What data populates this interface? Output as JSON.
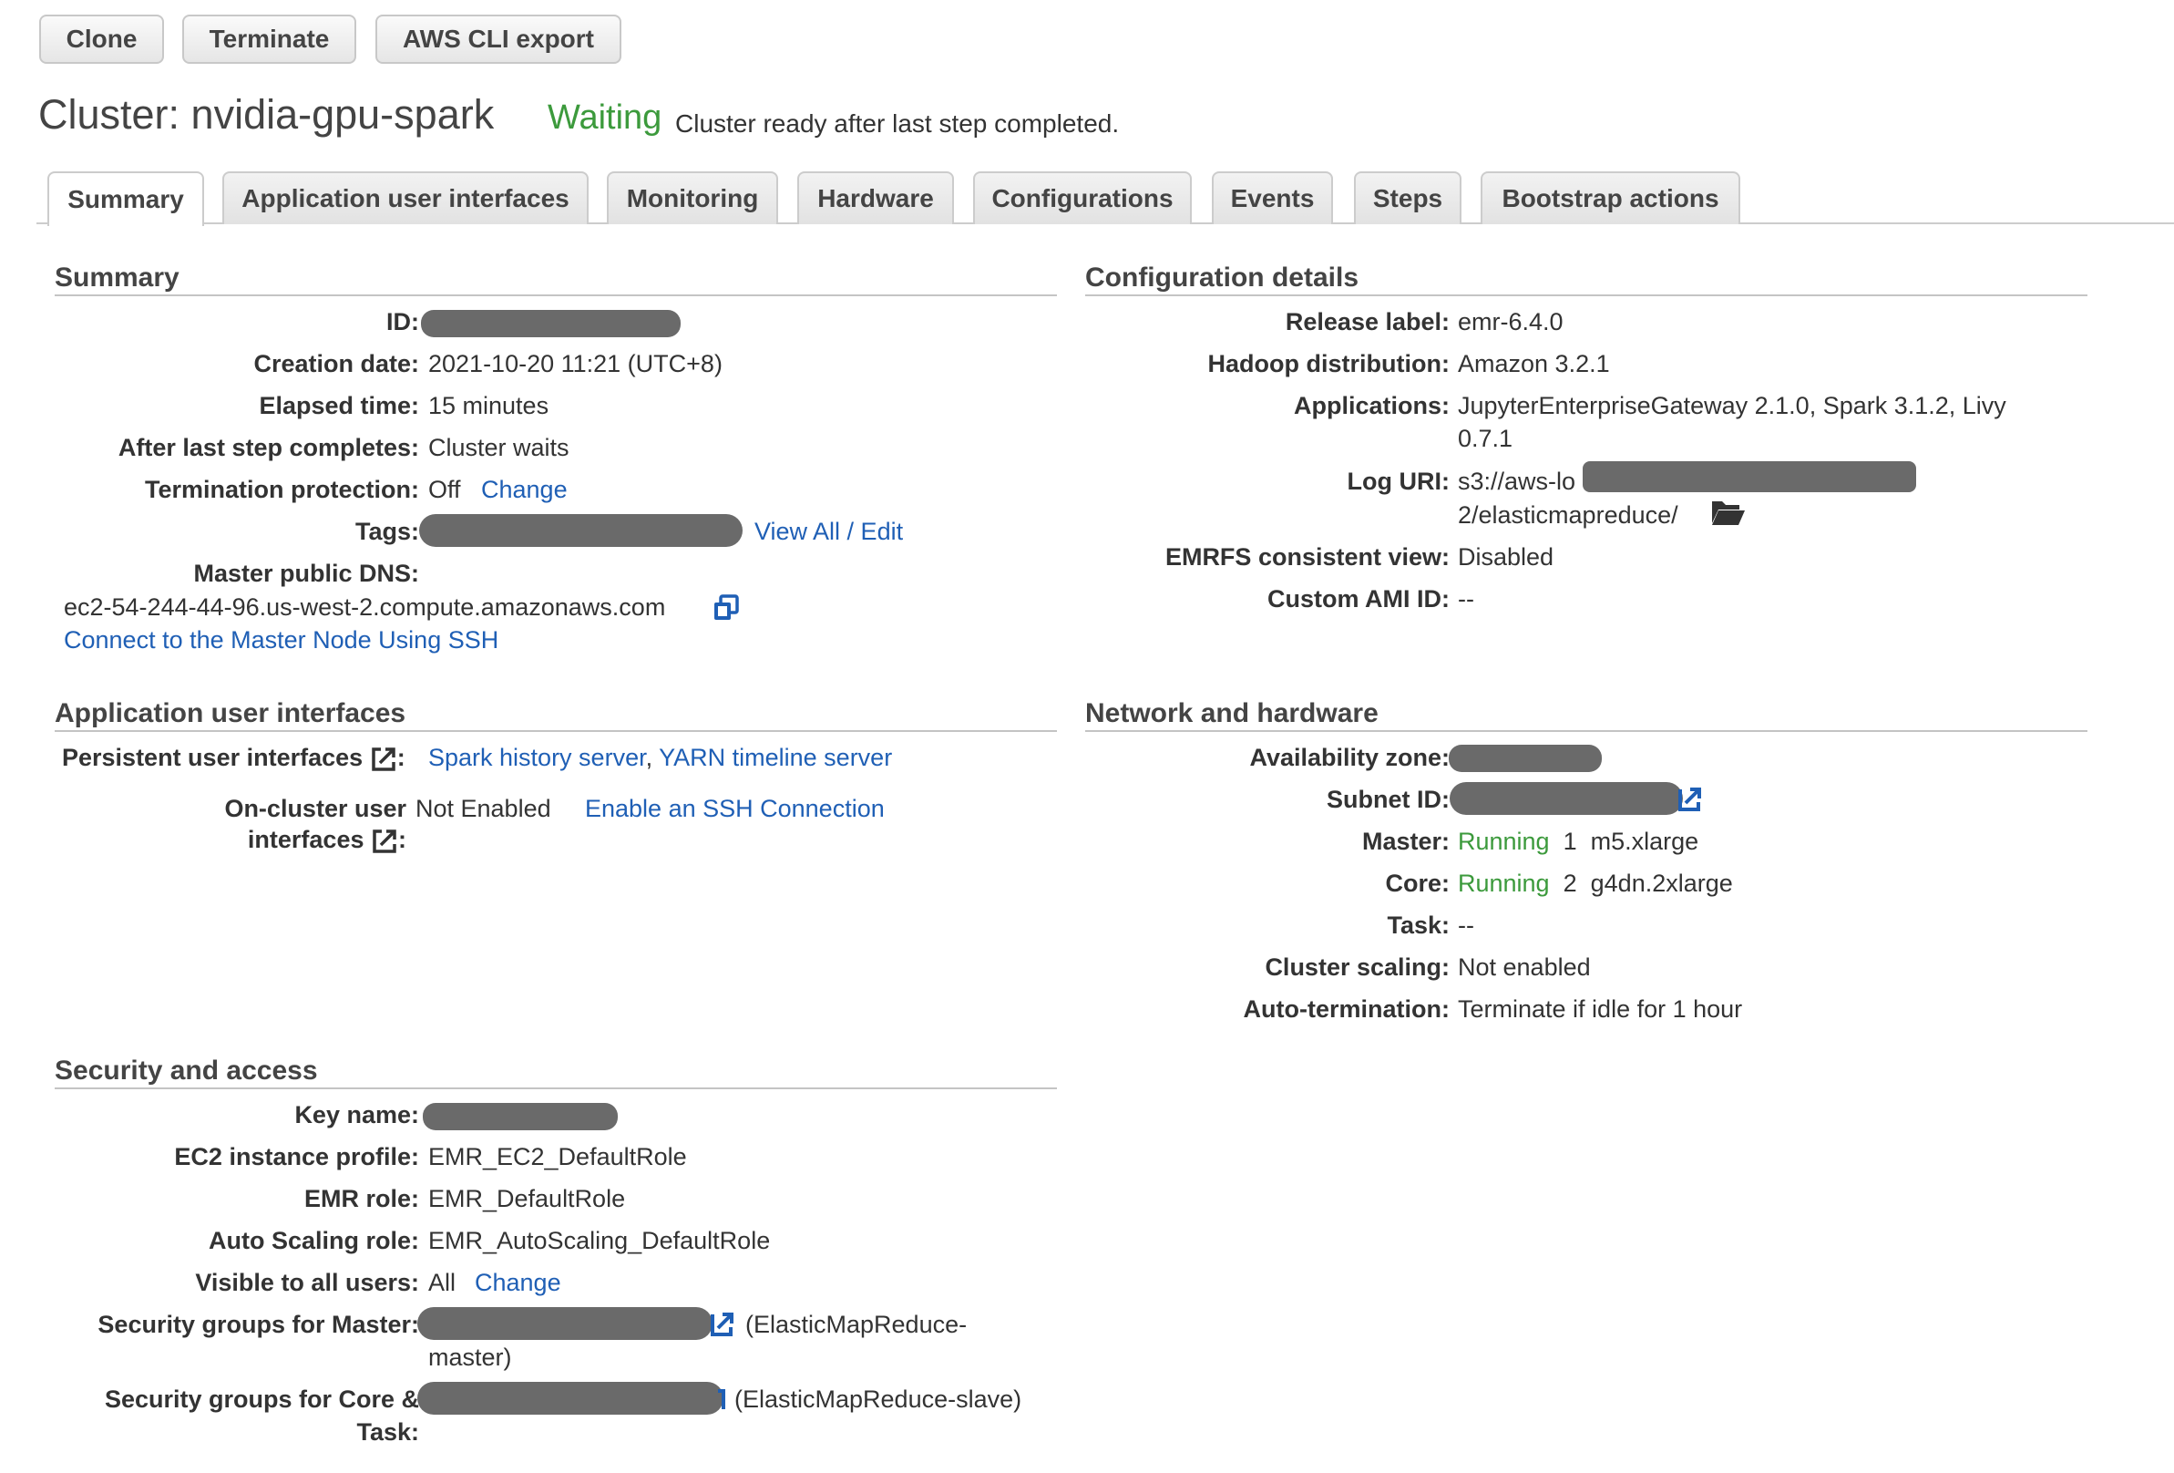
{
  "toolbar": {
    "clone": "Clone",
    "terminate": "Terminate",
    "cli_export": "AWS CLI export"
  },
  "header": {
    "title": "Cluster: nvidia-gpu-spark",
    "status": "Waiting",
    "status_message": "Cluster ready after last step completed."
  },
  "colors": {
    "link": "#1f5fb5",
    "status_green": "#3c9a3c"
  },
  "tabs": [
    {
      "label": "Summary",
      "active": true
    },
    {
      "label": "Application user interfaces"
    },
    {
      "label": "Monitoring"
    },
    {
      "label": "Hardware"
    },
    {
      "label": "Configurations"
    },
    {
      "label": "Events"
    },
    {
      "label": "Steps"
    },
    {
      "label": "Bootstrap actions"
    }
  ],
  "summary": {
    "heading": "Summary",
    "id_label": "ID:",
    "creation_label": "Creation date:",
    "creation_value": "2021-10-20 11:21 (UTC+8)",
    "elapsed_label": "Elapsed time:",
    "elapsed_value": "15 minutes",
    "after_step_label": "After last step completes:",
    "after_step_value": "Cluster waits",
    "termination_label": "Termination protection:",
    "termination_value": "Off",
    "termination_change": "Change",
    "tags_label": "Tags:",
    "tags_link": "View All / Edit",
    "dns_label": "Master public DNS:",
    "dns_value": "ec2-54-244-44-96.us-west-2.compute.amazonaws.com",
    "ssh_link": "Connect to the Master Node Using SSH"
  },
  "config": {
    "heading": "Configuration details",
    "release_label": "Release label:",
    "release_value": "emr-6.4.0",
    "hadoop_label": "Hadoop distribution:",
    "hadoop_value": "Amazon 3.2.1",
    "apps_label": "Applications:",
    "apps_value_line1": "JupyterEnterpriseGateway 2.1.0, Spark 3.1.2, Livy",
    "apps_value_line2": "0.7.1",
    "log_label": "Log URI:",
    "log_value_line1": "s3://aws-lo",
    "log_value_line2": "2/elasticmapreduce/",
    "emrfs_label": "EMRFS consistent view:",
    "emrfs_value": "Disabled",
    "ami_label": "Custom AMI ID:",
    "ami_value": "--"
  },
  "app_ui": {
    "heading": "Application user interfaces",
    "persistent_label": "Persistent user interfaces",
    "persistent_link1": "Spark history server",
    "persistent_sep": ",",
    "persistent_link2": "YARN timeline server",
    "oncluster_label_line1": "On-cluster user",
    "oncluster_label_line2": "interfaces",
    "oncluster_value": "Not Enabled",
    "oncluster_link": "Enable an SSH Connection"
  },
  "network": {
    "heading": "Network and hardware",
    "az_label": "Availability zone:",
    "subnet_label": "Subnet ID:",
    "master_label": "Master:",
    "master_status": "Running",
    "master_count": "1",
    "master_type": "m5.xlarge",
    "core_label": "Core:",
    "core_status": "Running",
    "core_count": "2",
    "core_type": "g4dn.2xlarge",
    "task_label": "Task:",
    "task_value": "--",
    "scaling_label": "Cluster scaling:",
    "scaling_value": "Not enabled",
    "autoterm_label": "Auto-termination:",
    "autoterm_value": "Terminate if idle for 1 hour"
  },
  "security": {
    "heading": "Security and access",
    "key_label": "Key name:",
    "ec2_label": "EC2 instance profile:",
    "ec2_value": "EMR_EC2_DefaultRole",
    "emr_role_label": "EMR role:",
    "emr_role_value": "EMR_DefaultRole",
    "autoscale_label": "Auto Scaling role:",
    "autoscale_value": "EMR_AutoScaling_DefaultRole",
    "visible_label": "Visible to all users:",
    "visible_value": "All",
    "visible_change": "Change",
    "sg_master_label": "Security groups for Master:",
    "sg_master_value_line1": "(ElasticMapReduce-",
    "sg_master_value_line2": "master)",
    "sg_core_label_line1": "Security groups for Core &",
    "sg_core_label_line2": "Task:",
    "sg_core_value": "(ElasticMapReduce-slave)"
  }
}
